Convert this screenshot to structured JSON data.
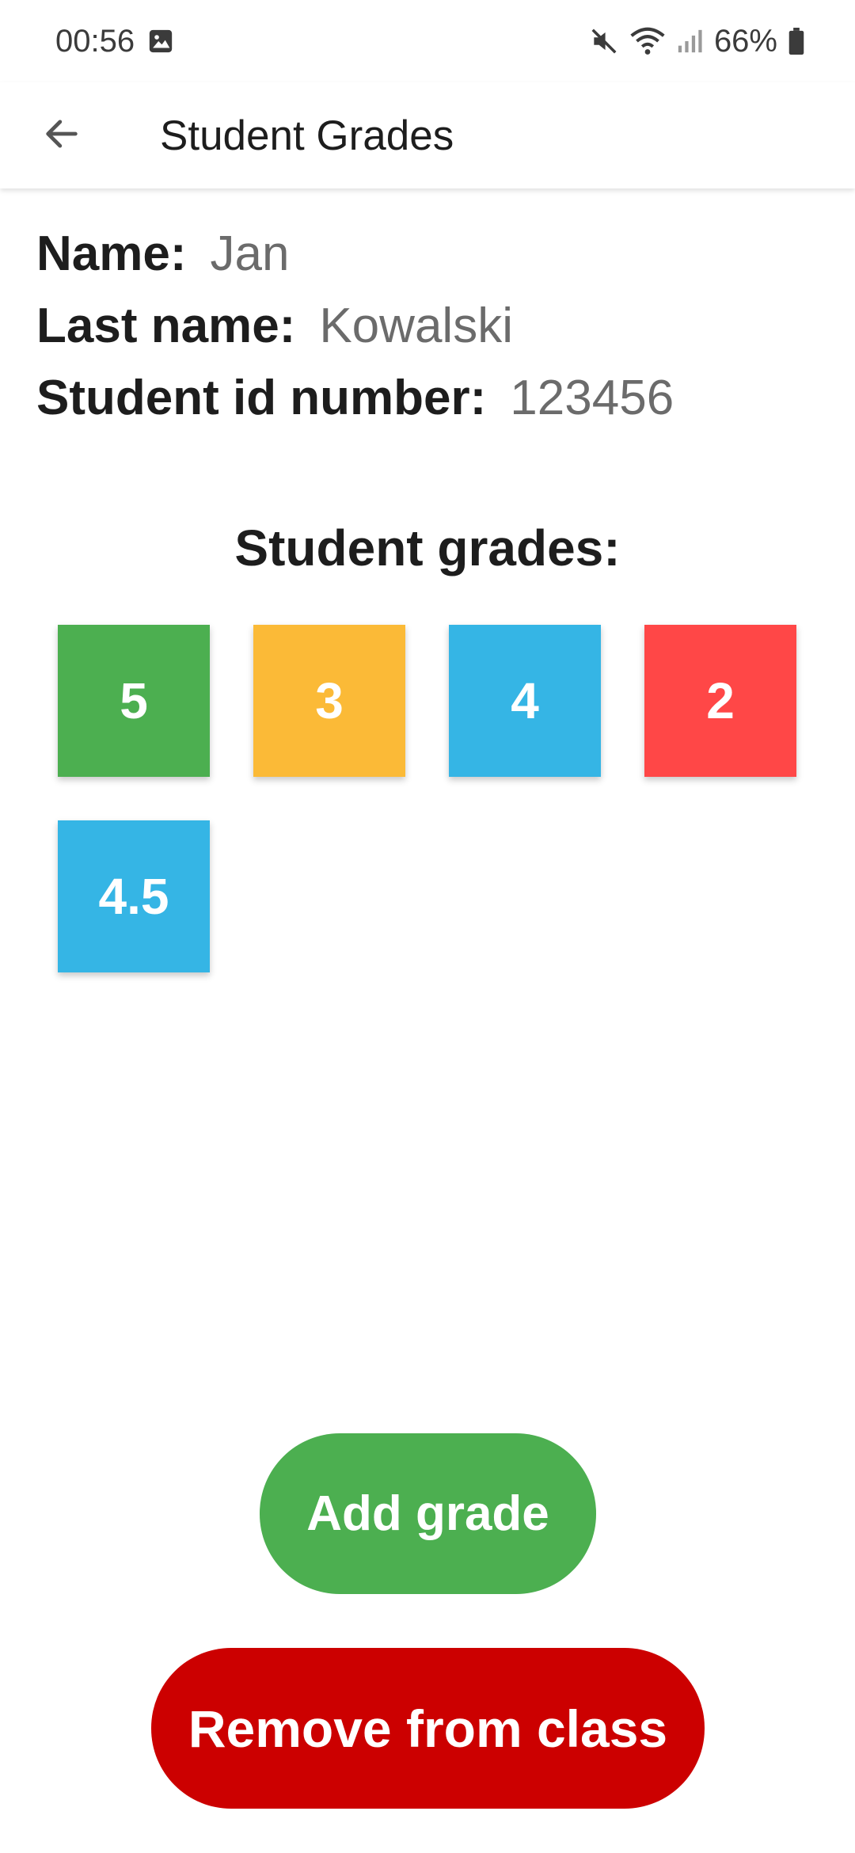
{
  "status_bar": {
    "time": "00:56",
    "battery": "66%",
    "icons": [
      "gallery-notification-icon",
      "mute-icon",
      "wifi-icon",
      "signal-icon",
      "battery-icon"
    ]
  },
  "app_bar": {
    "title": "Student Grades",
    "back_icon": "arrow-left-icon"
  },
  "student": {
    "name_label": "Name:",
    "name_value": "Jan",
    "last_name_label": "Last name:",
    "last_name_value": "Kowalski",
    "id_label": "Student id number:",
    "id_value": "123456"
  },
  "grades_heading": "Student grades:",
  "grades": [
    {
      "value": "5",
      "color": "#4caf50"
    },
    {
      "value": "3",
      "color": "#fbba37"
    },
    {
      "value": "4",
      "color": "#35b5e5"
    },
    {
      "value": "2",
      "color": "#ff4747"
    },
    {
      "value": "4.5",
      "color": "#35b5e5"
    }
  ],
  "actions": {
    "add_grade_label": "Add grade",
    "add_grade_color": "#4caf50",
    "remove_label": "Remove from class",
    "remove_color": "#cc0000"
  }
}
